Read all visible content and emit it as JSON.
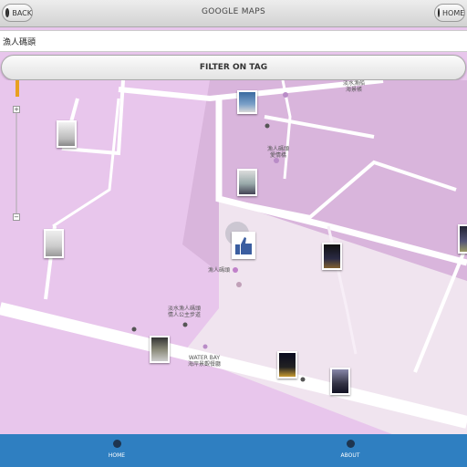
{
  "header": {
    "title": "GOOGLE MAPS",
    "back_label": "BACK",
    "home_label": "HOME"
  },
  "search": {
    "value": "漁人碼頭"
  },
  "filter": {
    "label": "FILTER ON TAG"
  },
  "map": {
    "labels": {
      "top_right": "淡水漁船\n海景帳",
      "center": "漁人碼頭\n愛情橋",
      "pier": "漁人碼頭",
      "park": "淡水漁人碼頭\n情人公主步道",
      "waterbay": "WATER BAY\n海岸景觀餐廳"
    }
  },
  "bottom_nav": {
    "home_label": "HOME",
    "about_label": "ABOUT"
  },
  "colors": {
    "nav_blue": "#2f7fc1",
    "map_pink": "#e8c6ec",
    "map_lilac": "#d9b5dc"
  }
}
